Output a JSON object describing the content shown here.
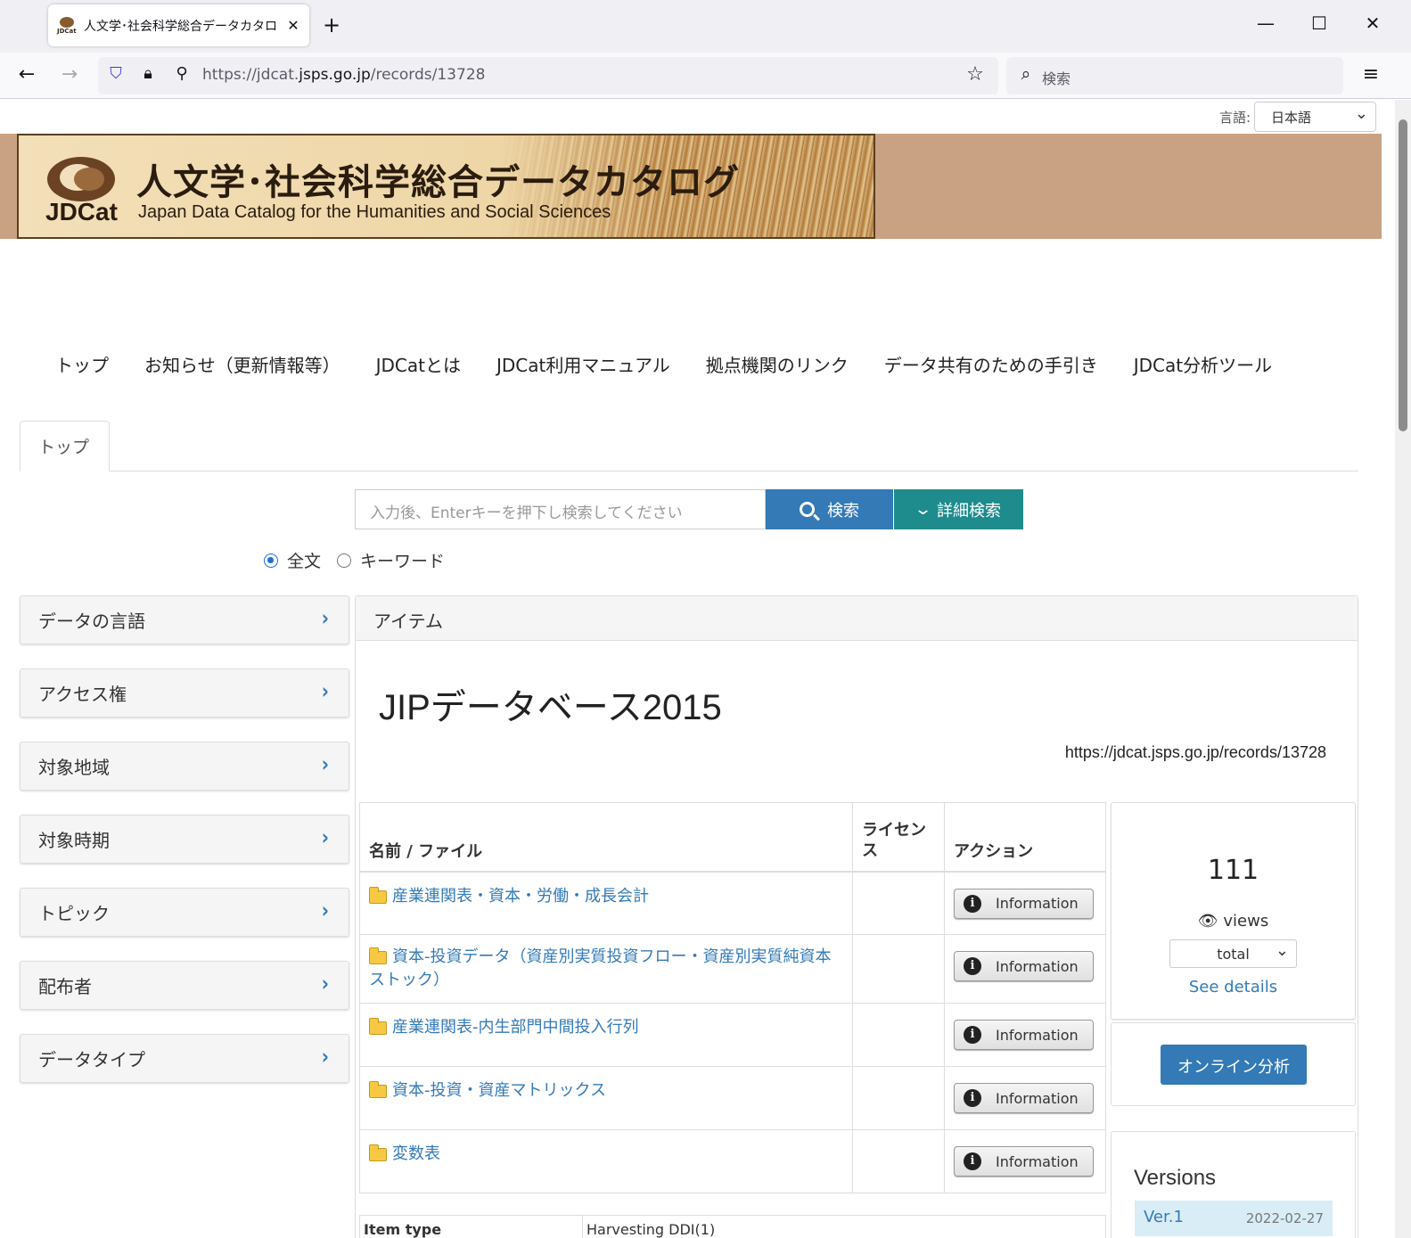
{
  "browser": {
    "tab_title": "人文学･社会科学総合データカタロ",
    "url_prefix": "https://jdcat.",
    "url_domain": "jsps.go.jp",
    "url_path": "/records/13728",
    "search_placeholder": "検索",
    "favicon_text": "JDCat"
  },
  "header": {
    "language_label": "言語:",
    "language_value": "日本語",
    "banner_title": "人文学･社会科学総合データカタログ",
    "banner_subtitle": "Japan Data Catalog for the Humanities and Social Sciences",
    "banner_logo": "JDCat"
  },
  "nav": {
    "items": [
      "トップ",
      "お知らせ（更新情報等）",
      "JDCatとは",
      "JDCat利用マニュアル",
      "拠点機関のリンク",
      "データ共有のための手引き",
      "JDCat分析ツール"
    ]
  },
  "tabs": {
    "top": "トップ"
  },
  "search": {
    "placeholder": "入力後、Enterキーを押下し検索してください",
    "search_button": "検索",
    "advanced_button": "詳細検索",
    "radio_fulltext": "全文",
    "radio_keyword": "キーワード",
    "selected": "全文"
  },
  "facets": [
    "データの言語",
    "アクセス権",
    "対象地域",
    "対象時期",
    "トピック",
    "配布者",
    "データタイプ"
  ],
  "item": {
    "panel_heading": "アイテム",
    "title": "JIPデータベース2015",
    "url": "https://jdcat.jsps.go.jp/records/13728",
    "table": {
      "col_name": "名前 / ファイル",
      "col_license": "ライセンス",
      "col_action": "アクション",
      "action_label": "Information",
      "rows": [
        {
          "name": "産業連関表・資本・労働・成長会計",
          "license": ""
        },
        {
          "name": "資本-投資データ（資産別実質投資フロー・資産別実質純資本ストック）",
          "license": ""
        },
        {
          "name": "産業連関表-内生部門中間投入行列",
          "license": ""
        },
        {
          "name": "資本-投資・資産マトリックス",
          "license": ""
        },
        {
          "name": "変数表",
          "license": ""
        }
      ]
    },
    "meta": {
      "item_type_label": "Item type",
      "item_type_value": "Harvesting DDI(1)"
    }
  },
  "stats": {
    "views": "111",
    "views_label": "views",
    "period": "total",
    "see_details": "See details"
  },
  "analysis_button": "オンライン分析",
  "versions": {
    "title": "Versions",
    "rows": [
      {
        "label": "Ver.1",
        "date": "2022-02-27"
      }
    ]
  }
}
